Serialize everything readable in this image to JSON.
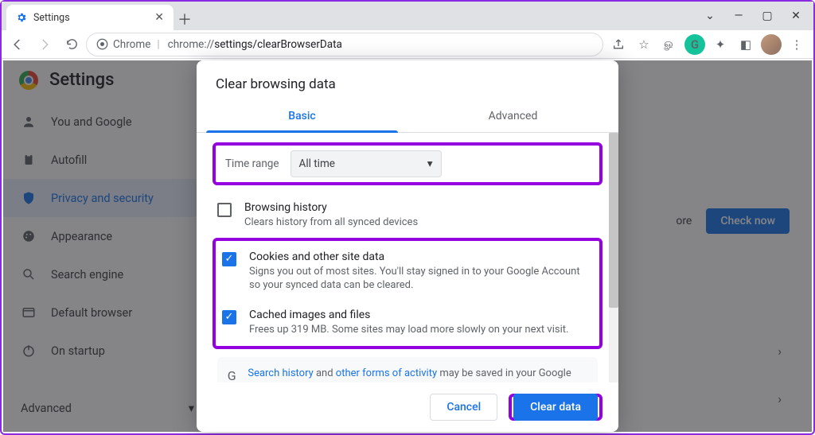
{
  "window": {
    "tab_title": "Settings",
    "controls": {
      "minimize": "—",
      "maximize": "▢",
      "close": "✕",
      "dropdown": "⌄"
    }
  },
  "addressbar": {
    "scheme_label": "Chrome",
    "separator": "|",
    "url_host": "chrome://",
    "url_path1": "settings/",
    "url_path2": "clearBrowserData"
  },
  "settings": {
    "header": "Settings",
    "nav": {
      "you": "You and Google",
      "autofill": "Autofill",
      "privacy": "Privacy and security",
      "appearance": "Appearance",
      "search": "Search engine",
      "default_browser": "Default browser",
      "startup": "On startup",
      "advanced": "Advanced"
    },
    "card": {
      "more": "ore",
      "check_now": "Check now"
    }
  },
  "dialog": {
    "title": "Clear browsing data",
    "tabs": {
      "basic": "Basic",
      "advanced": "Advanced"
    },
    "time_range_label": "Time range",
    "time_range_value": "All time",
    "items": {
      "history": {
        "checked": false,
        "title": "Browsing history",
        "desc": "Clears history from all synced devices"
      },
      "cookies": {
        "checked": true,
        "title": "Cookies and other site data",
        "desc": "Signs you out of most sites. You'll stay signed in to your Google Account so your synced data can be cleared."
      },
      "cache": {
        "checked": true,
        "title": "Cached images and files",
        "desc": "Frees up 319 MB. Some sites may load more slowly on your next visit."
      }
    },
    "info": {
      "link1": "Search history",
      "mid1": " and ",
      "link2": "other forms of activity",
      "tail": " may be saved in your Google Account when you're signed in. You can delete them anytime."
    },
    "actions": {
      "cancel": "Cancel",
      "clear": "Clear data"
    }
  },
  "icons": {
    "check": "✓",
    "caret": "▾",
    "chevron_right": "›"
  }
}
